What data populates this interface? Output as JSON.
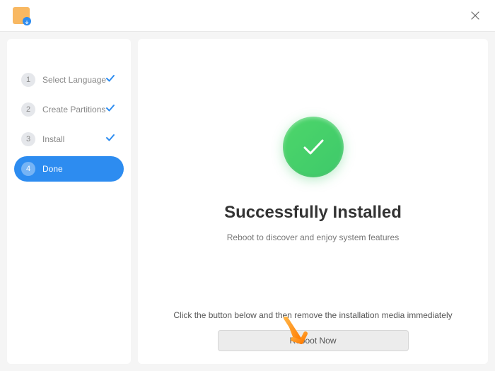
{
  "header": {
    "close_tooltip": "Close"
  },
  "sidebar": {
    "steps": [
      {
        "num": "1",
        "label": "Select Language",
        "done": true
      },
      {
        "num": "2",
        "label": "Create Partitions",
        "done": true
      },
      {
        "num": "3",
        "label": "Install",
        "done": true
      },
      {
        "num": "4",
        "label": "Done",
        "active": true
      }
    ]
  },
  "content": {
    "title": "Successfully Installed",
    "subtitle": "Reboot to discover and enjoy system features",
    "hint": "Click the button below and then remove the installation media immediately",
    "reboot_label": "Reboot Now"
  }
}
